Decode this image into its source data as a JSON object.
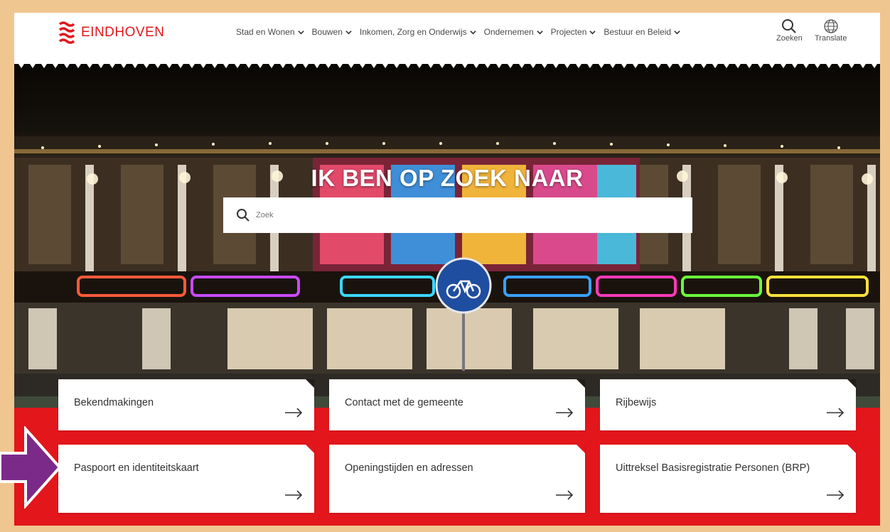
{
  "header": {
    "logo_text": "EINDHOVEN",
    "nav": [
      {
        "label": "Stad en Wonen"
      },
      {
        "label": "Bouwen"
      },
      {
        "label": "Inkomen, Zorg en Onderwijs"
      },
      {
        "label": "Ondernemen"
      },
      {
        "label": "Projecten"
      },
      {
        "label": "Bestuur en Beleid"
      }
    ],
    "search_label": "Zoeken",
    "translate_label": "Translate"
  },
  "hero": {
    "title": "IK BEN OP ZOEK NAAR",
    "search_placeholder": "Zoek"
  },
  "tiles": [
    {
      "label": "Bekendmakingen"
    },
    {
      "label": "Contact met de gemeente"
    },
    {
      "label": "Rijbewijs"
    },
    {
      "label": "Paspoort en identiteitskaart"
    },
    {
      "label": "Openingstijden en adressen"
    },
    {
      "label": "Uittreksel Basisregistratie Personen (BRP)"
    }
  ],
  "colors": {
    "brand_red": "#e2161b",
    "frame_border": "#f0c690",
    "annotation_arrow": "#7b2a8a"
  }
}
